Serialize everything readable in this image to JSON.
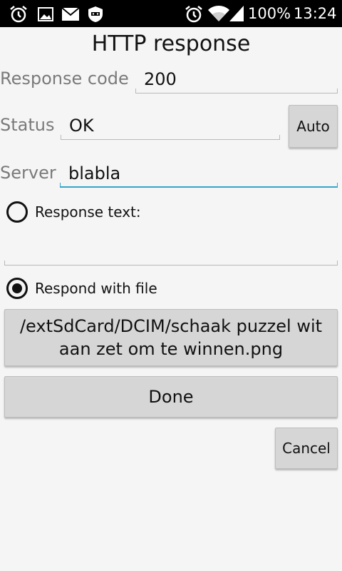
{
  "status_bar": {
    "battery": "100%",
    "time": "13:24"
  },
  "title": "HTTP response",
  "form": {
    "response_code_label": "Response code",
    "response_code_value": "200",
    "status_label": "Status",
    "status_value": "OK",
    "auto_button": "Auto",
    "server_label": "Server",
    "server_value": "blabla",
    "response_text_label": "Response text:",
    "response_text_value": "",
    "respond_with_file_label": "Respond with file",
    "selected_radio": "respond_with_file",
    "file_path": "/extSdCard/DCIM/schaak puzzel wit aan zet om te winnen.png",
    "done_button": "Done",
    "cancel_button": "Cancel"
  },
  "colors": {
    "accent": "#33a7c8",
    "background": "#f5f5f5",
    "button": "#d6d6d6"
  }
}
